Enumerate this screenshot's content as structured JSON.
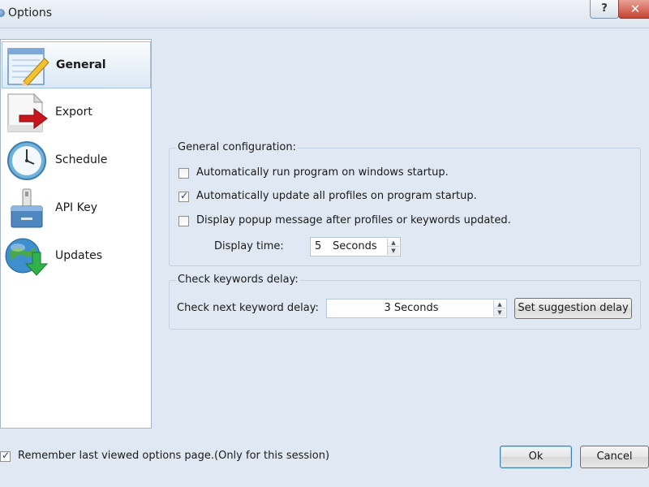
{
  "window": {
    "title": "Options",
    "help_label": "?",
    "close_label": "✕"
  },
  "sidebar": {
    "items": [
      {
        "label": "General",
        "icon": "notepad-pencil-icon",
        "active": true
      },
      {
        "label": "Export",
        "icon": "document-arrow-icon",
        "active": false
      },
      {
        "label": "Schedule",
        "icon": "clock-icon",
        "active": false
      },
      {
        "label": "API Key",
        "icon": "usb-key-icon",
        "active": false
      },
      {
        "label": "Updates",
        "icon": "globe-download-icon",
        "active": false
      }
    ]
  },
  "general_config": {
    "title": "General configuration:",
    "options": [
      {
        "label": "Automatically run program on windows startup.",
        "checked": false
      },
      {
        "label": "Automatically update all profiles on program startup.",
        "checked": true
      },
      {
        "label": "Display popup message after profiles or keywords updated.",
        "checked": false
      }
    ],
    "display_time": {
      "label": "Display time:",
      "value": "5",
      "unit": "Seconds"
    }
  },
  "keyword_delay": {
    "title": "Check keywords delay:",
    "label": "Check next keyword delay:",
    "value": "3 Seconds",
    "suggestion_button": "Set suggestion delay"
  },
  "footer": {
    "remember_label": "Remember last viewed options page.(Only for this session)",
    "remember_checked": true,
    "ok_label": "Ok",
    "cancel_label": "Cancel"
  }
}
